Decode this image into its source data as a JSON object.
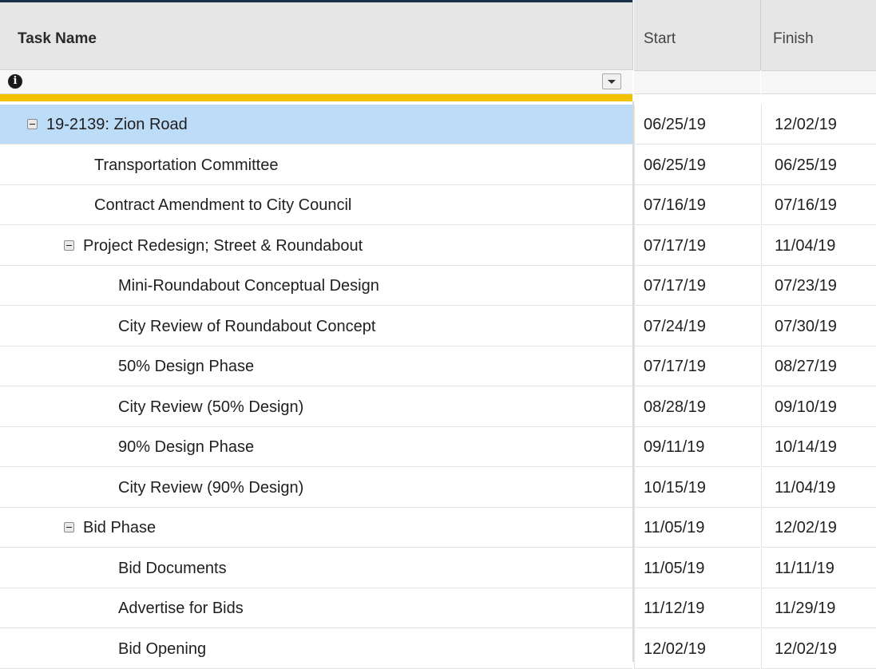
{
  "columns": {
    "task": "Task Name",
    "start": "Start",
    "finish": "Finish"
  },
  "filter": {
    "info_icon": "info-icon",
    "dropdown_icon": "chevron-down-icon"
  },
  "accent": {
    "summary_bar": "#f2c200",
    "selection": "#bcdcf8",
    "header_border": "#18324a"
  },
  "rows": [
    {
      "name": "19-2139: Zion Road",
      "start": "06/25/19",
      "finish": "12/02/19",
      "level": 0,
      "collapsible": true,
      "selected": true
    },
    {
      "name": "Transportation Committee",
      "start": "06/25/19",
      "finish": "06/25/19",
      "level": 1,
      "collapsible": false,
      "selected": false
    },
    {
      "name": "Contract Amendment to City Council",
      "start": "07/16/19",
      "finish": "07/16/19",
      "level": 1,
      "collapsible": false,
      "selected": false
    },
    {
      "name": "Project Redesign; Street & Roundabout",
      "start": "07/17/19",
      "finish": "11/04/19",
      "level": 1,
      "collapsible": true,
      "selected": false
    },
    {
      "name": "Mini-Roundabout Conceptual Design",
      "start": "07/17/19",
      "finish": "07/23/19",
      "level": 2,
      "collapsible": false,
      "selected": false
    },
    {
      "name": "City Review of Roundabout Concept",
      "start": "07/24/19",
      "finish": "07/30/19",
      "level": 2,
      "collapsible": false,
      "selected": false
    },
    {
      "name": "50% Design Phase",
      "start": "07/17/19",
      "finish": "08/27/19",
      "level": 2,
      "collapsible": false,
      "selected": false
    },
    {
      "name": "City Review (50% Design)",
      "start": "08/28/19",
      "finish": "09/10/19",
      "level": 2,
      "collapsible": false,
      "selected": false
    },
    {
      "name": "90% Design Phase",
      "start": "09/11/19",
      "finish": "10/14/19",
      "level": 2,
      "collapsible": false,
      "selected": false
    },
    {
      "name": "City Review (90% Design)",
      "start": "10/15/19",
      "finish": "11/04/19",
      "level": 2,
      "collapsible": false,
      "selected": false
    },
    {
      "name": "Bid Phase",
      "start": "11/05/19",
      "finish": "12/02/19",
      "level": 1,
      "collapsible": true,
      "selected": false
    },
    {
      "name": "Bid Documents",
      "start": "11/05/19",
      "finish": "11/11/19",
      "level": 2,
      "collapsible": false,
      "selected": false
    },
    {
      "name": "Advertise for Bids",
      "start": "11/12/19",
      "finish": "11/29/19",
      "level": 2,
      "collapsible": false,
      "selected": false
    },
    {
      "name": "Bid Opening",
      "start": "12/02/19",
      "finish": "12/02/19",
      "level": 2,
      "collapsible": false,
      "selected": false
    }
  ]
}
